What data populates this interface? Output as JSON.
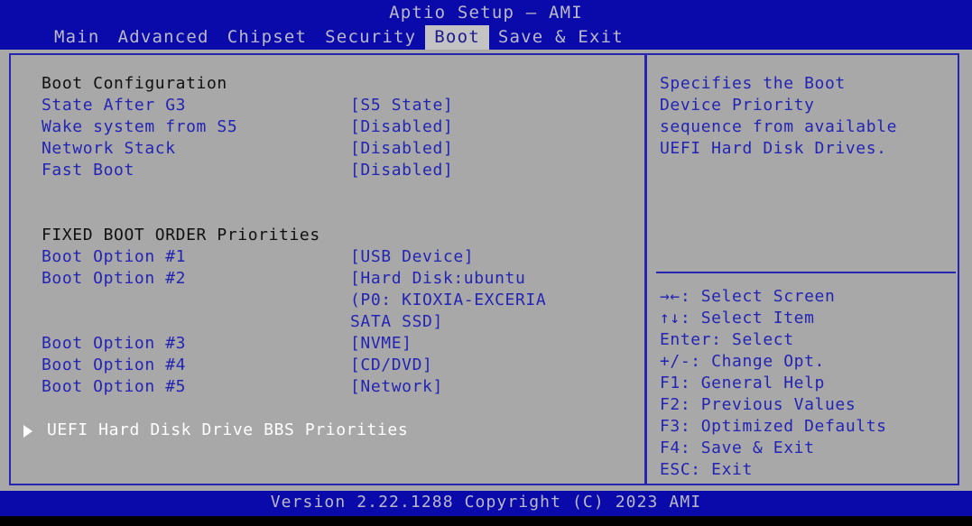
{
  "window": {
    "title": "Aptio Setup – AMI",
    "footer": "Version 2.22.1288 Copyright (C) 2023 AMI"
  },
  "tabs": [
    {
      "label": "Main",
      "active": false
    },
    {
      "label": "Advanced",
      "active": false
    },
    {
      "label": "Chipset",
      "active": false
    },
    {
      "label": "Security",
      "active": false
    },
    {
      "label": "Boot",
      "active": true
    },
    {
      "label": "Save & Exit",
      "active": false
    }
  ],
  "left_panel": {
    "section_boot_config": {
      "header": "Boot Configuration",
      "rows": [
        {
          "label": "State After G3",
          "value": "[S5 State]"
        },
        {
          "label": "Wake system from S5",
          "value": "[Disabled]"
        },
        {
          "label": "Network Stack",
          "value": "[Disabled]"
        },
        {
          "label": "Fast Boot",
          "value": "[Disabled]"
        }
      ]
    },
    "section_boot_order": {
      "header": "FIXED BOOT ORDER Priorities",
      "rows": [
        {
          "label": "Boot Option #1",
          "value": "[USB Device]"
        },
        {
          "label": "Boot Option #2",
          "value": "[Hard Disk:ubuntu"
        },
        {
          "label": "",
          "value": "(P0: KIOXIA-EXCERIA"
        },
        {
          "label": "",
          "value": "SATA SSD]"
        },
        {
          "label": "Boot Option #3",
          "value": "[NVME]"
        },
        {
          "label": "Boot Option #4",
          "value": "[CD/DVD]"
        },
        {
          "label": "Boot Option #5",
          "value": "[Network]"
        }
      ]
    },
    "submenu": {
      "label": "UEFI Hard Disk Drive BBS Priorities",
      "arrow_icon": "triangle-right-icon"
    }
  },
  "right_panel": {
    "description": [
      "Specifies the Boot",
      "Device Priority",
      "sequence from available",
      "UEFI Hard Disk Drives."
    ],
    "key_help": [
      "→←: Select Screen",
      "↑↓: Select Item",
      "Enter: Select",
      "+/-: Change Opt.",
      "F1: General Help",
      "F2: Previous Values",
      "F3: Optimized Defaults",
      "F4: Save & Exit",
      "ESC: Exit"
    ]
  },
  "colors": {
    "bios_blue": "#0a0aaa",
    "panel_gray": "#a8a8a8",
    "item_blue": "#2424b4",
    "header_black": "#101010",
    "selected_white": "#ffffff",
    "title_silver": "#b9b9c9",
    "border_blue": "#2626b0"
  }
}
